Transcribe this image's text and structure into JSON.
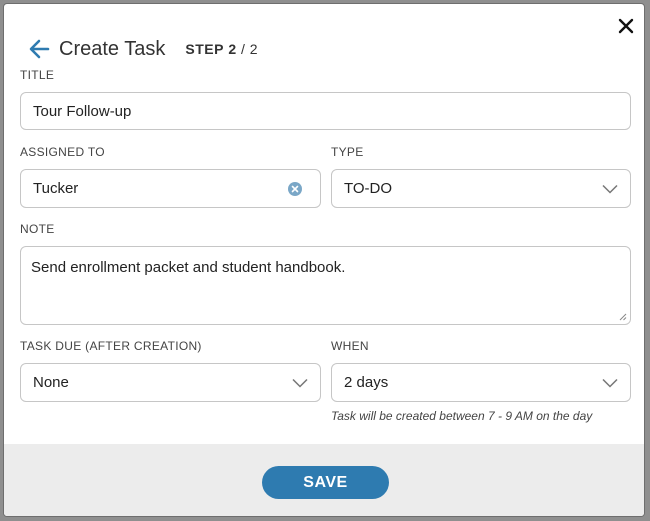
{
  "dialog": {
    "title": "Create Task",
    "step_prefix": "STEP",
    "step_current": "2",
    "step_sep": " / 2"
  },
  "form": {
    "title_label": "TITLE",
    "title_value": "Tour Follow-up",
    "assigned_label": "ASSIGNED TO",
    "assigned_value": "Tucker",
    "type_label": "TYPE",
    "type_value": "TO-DO",
    "note_label": "NOTE",
    "note_value": "Send enrollment packet and student handbook.",
    "due_label": "TASK DUE (AFTER CREATION)",
    "due_value": "None",
    "when_label": "WHEN",
    "when_value": "2 days",
    "when_hint": "Task will be created between 7 - 9 AM on the day"
  },
  "footer": {
    "save_label": "SAVE"
  },
  "colors": {
    "accent": "#2e7bb0",
    "clear_icon": "#7aa7c7"
  },
  "icons": {
    "back": "arrow-left-icon",
    "close": "close-icon",
    "clear": "clear-circle-icon",
    "chevron": "chevron-down-icon",
    "resize": "resize-grip-icon"
  }
}
